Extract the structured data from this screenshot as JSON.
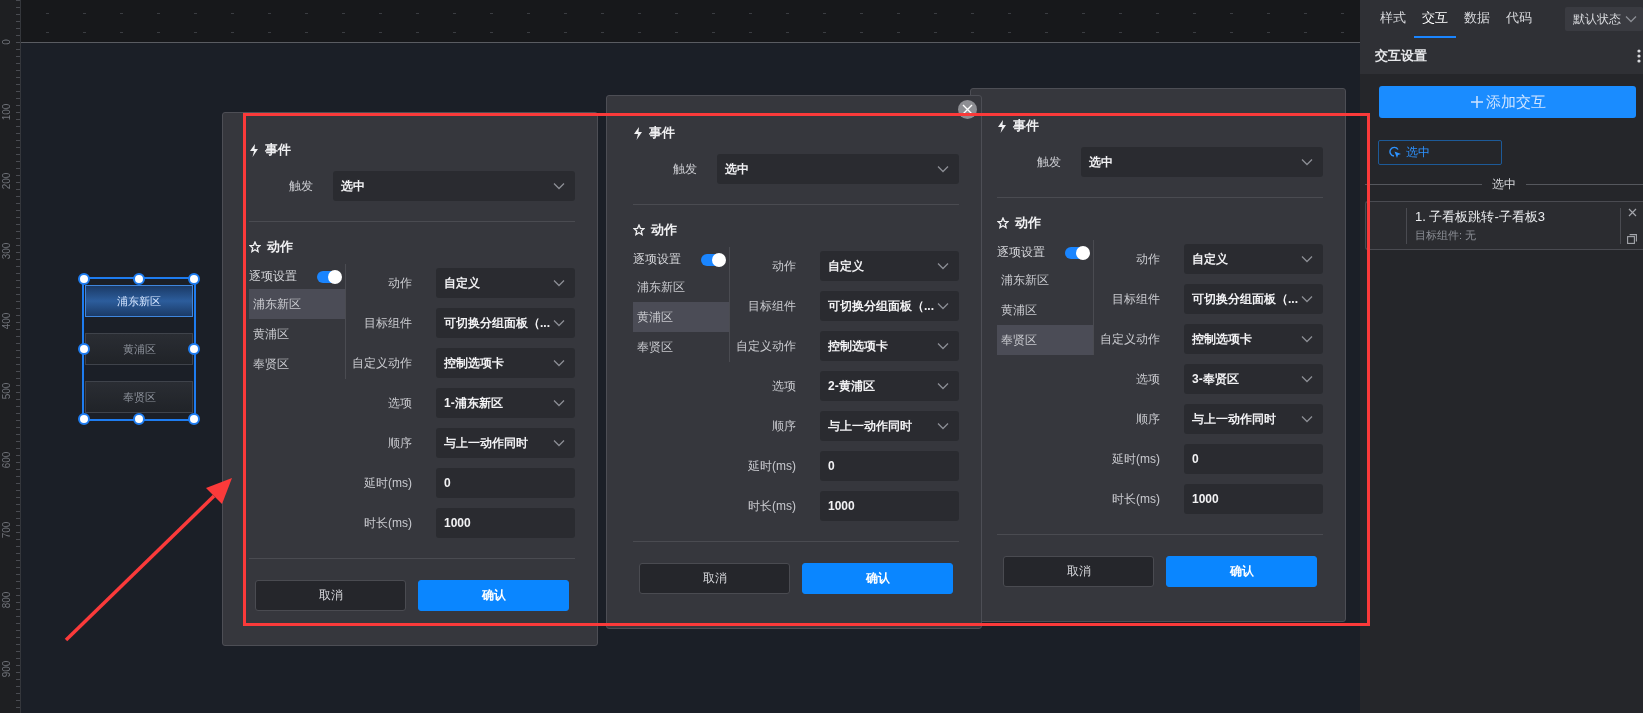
{
  "ruler": {
    "labels": [
      "0",
      "100",
      "200",
      "300",
      "400",
      "500",
      "600",
      "700",
      "800",
      "900"
    ]
  },
  "component": {
    "tabs": [
      {
        "label": "浦东新区",
        "selected": true
      },
      {
        "label": "黄浦区",
        "selected": false
      },
      {
        "label": "奉贤区",
        "selected": false
      }
    ]
  },
  "dialogs": [
    {
      "closable": false,
      "event": {
        "title": "事件",
        "trigger_label": "触发",
        "trigger_value": "选中"
      },
      "action": {
        "title": "动作",
        "per_item": {
          "label": "逐项设置",
          "on": true
        },
        "items": [
          {
            "label": "浦东新区",
            "selected": true
          },
          {
            "label": "黄浦区",
            "selected": false
          },
          {
            "label": "奉贤区",
            "selected": false
          }
        ],
        "fields": [
          {
            "label": "动作",
            "value": "自定义",
            "kind": "select"
          },
          {
            "label": "目标组件",
            "value": "可切换分组面板（...",
            "kind": "select"
          },
          {
            "label": "自定义动作",
            "value": "控制选项卡",
            "kind": "select"
          },
          {
            "label": "选项",
            "value": "1-浦东新区",
            "kind": "select"
          },
          {
            "label": "顺序",
            "value": "与上一动作同时",
            "kind": "select"
          },
          {
            "label": "延时(ms)",
            "value": "0",
            "kind": "input"
          },
          {
            "label": "时长(ms)",
            "value": "1000",
            "kind": "input"
          }
        ]
      },
      "buttons": [
        {
          "label": "取消",
          "kind": "secondary"
        },
        {
          "label": "确认",
          "kind": "primary"
        }
      ]
    },
    {
      "closable": true,
      "event": {
        "title": "事件",
        "trigger_label": "触发",
        "trigger_value": "选中"
      },
      "action": {
        "title": "动作",
        "per_item": {
          "label": "逐项设置",
          "on": true
        },
        "items": [
          {
            "label": "浦东新区",
            "selected": false
          },
          {
            "label": "黄浦区",
            "selected": true
          },
          {
            "label": "奉贤区",
            "selected": false
          }
        ],
        "fields": [
          {
            "label": "动作",
            "value": "自定义",
            "kind": "select"
          },
          {
            "label": "目标组件",
            "value": "可切换分组面板（...",
            "kind": "select"
          },
          {
            "label": "自定义动作",
            "value": "控制选项卡",
            "kind": "select"
          },
          {
            "label": "选项",
            "value": "2-黄浦区",
            "kind": "select"
          },
          {
            "label": "顺序",
            "value": "与上一动作同时",
            "kind": "select"
          },
          {
            "label": "延时(ms)",
            "value": "0",
            "kind": "input"
          },
          {
            "label": "时长(ms)",
            "value": "1000",
            "kind": "input"
          }
        ]
      },
      "buttons": [
        {
          "label": "取消",
          "kind": "secondary"
        },
        {
          "label": "确认",
          "kind": "primary"
        }
      ]
    },
    {
      "closable": false,
      "event": {
        "title": "事件",
        "trigger_label": "触发",
        "trigger_value": "选中"
      },
      "action": {
        "title": "动作",
        "per_item": {
          "label": "逐项设置",
          "on": true
        },
        "items": [
          {
            "label": "浦东新区",
            "selected": false
          },
          {
            "label": "黄浦区",
            "selected": false
          },
          {
            "label": "奉贤区",
            "selected": true
          }
        ],
        "fields": [
          {
            "label": "动作",
            "value": "自定义",
            "kind": "select"
          },
          {
            "label": "目标组件",
            "value": "可切换分组面板（...",
            "kind": "select"
          },
          {
            "label": "自定义动作",
            "value": "控制选项卡",
            "kind": "select"
          },
          {
            "label": "选项",
            "value": "3-奉贤区",
            "kind": "select"
          },
          {
            "label": "顺序",
            "value": "与上一动作同时",
            "kind": "select"
          },
          {
            "label": "延时(ms)",
            "value": "0",
            "kind": "input"
          },
          {
            "label": "时长(ms)",
            "value": "1000",
            "kind": "input"
          }
        ]
      },
      "buttons": [
        {
          "label": "取消",
          "kind": "secondary"
        },
        {
          "label": "确认",
          "kind": "primary"
        }
      ]
    }
  ],
  "panel": {
    "tabs": [
      {
        "label": "样式",
        "selected": false
      },
      {
        "label": "交互",
        "selected": true
      },
      {
        "label": "数据",
        "selected": false
      },
      {
        "label": "代码",
        "selected": false
      }
    ],
    "state_select": "默认状态",
    "section_title": "交互设置",
    "add_button": "添加交互",
    "trigger_tag": "选中",
    "divider_label": "选中",
    "interaction": {
      "title": "1. 子看板跳转-子看板3",
      "target": "目标组件: 无"
    }
  }
}
